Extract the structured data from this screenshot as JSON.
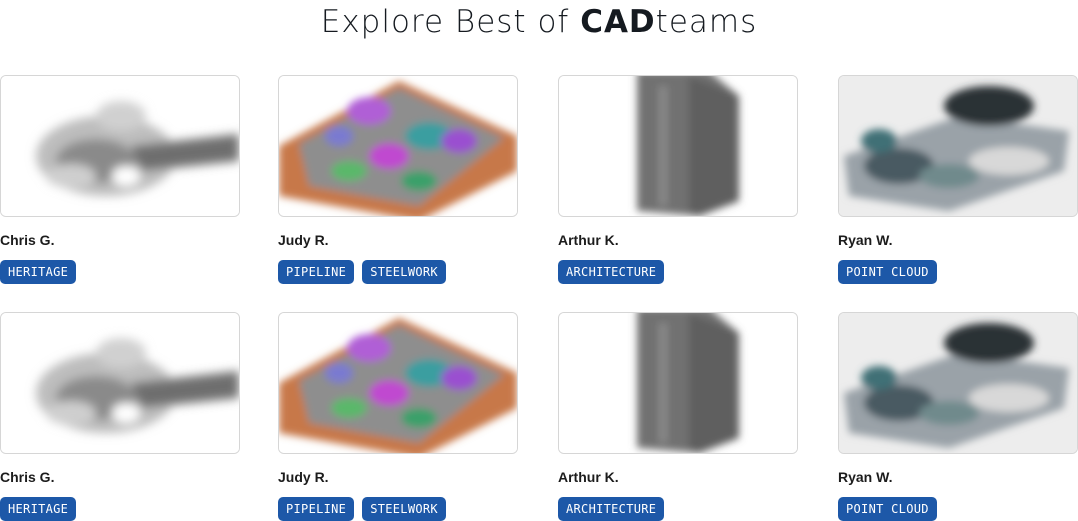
{
  "header": {
    "title_prefix": "Explore Best of ",
    "title_brand_bold": "CAD",
    "title_brand_rest": "teams"
  },
  "colors": {
    "tag_background": "#1d58a8",
    "tag_text": "#ffffff",
    "card_border": "#d6d6d6"
  },
  "rows": [
    {
      "cards": [
        {
          "name": "Chris G.",
          "image": "heritage-model-thumbnail",
          "tags": [
            "HERITAGE"
          ]
        },
        {
          "name": "Judy R.",
          "image": "pipeline-model-thumbnail",
          "tags": [
            "PIPELINE",
            "STEELWORK"
          ]
        },
        {
          "name": "Arthur K.",
          "image": "architecture-model-thumbnail",
          "tags": [
            "ARCHITECTURE"
          ]
        },
        {
          "name": "Ryan W.",
          "image": "point-cloud-model-thumbnail",
          "tags": [
            "POINT CLOUD"
          ]
        }
      ]
    },
    {
      "cards": [
        {
          "name": "Chris G.",
          "image": "heritage-model-thumbnail",
          "tags": [
            "HERITAGE"
          ]
        },
        {
          "name": "Judy R.",
          "image": "pipeline-model-thumbnail",
          "tags": [
            "PIPELINE",
            "STEELWORK"
          ]
        },
        {
          "name": "Arthur K.",
          "image": "architecture-model-thumbnail",
          "tags": [
            "ARCHITECTURE"
          ]
        },
        {
          "name": "Ryan W.",
          "image": "point-cloud-model-thumbnail",
          "tags": [
            "POINT CLOUD"
          ]
        }
      ]
    }
  ]
}
